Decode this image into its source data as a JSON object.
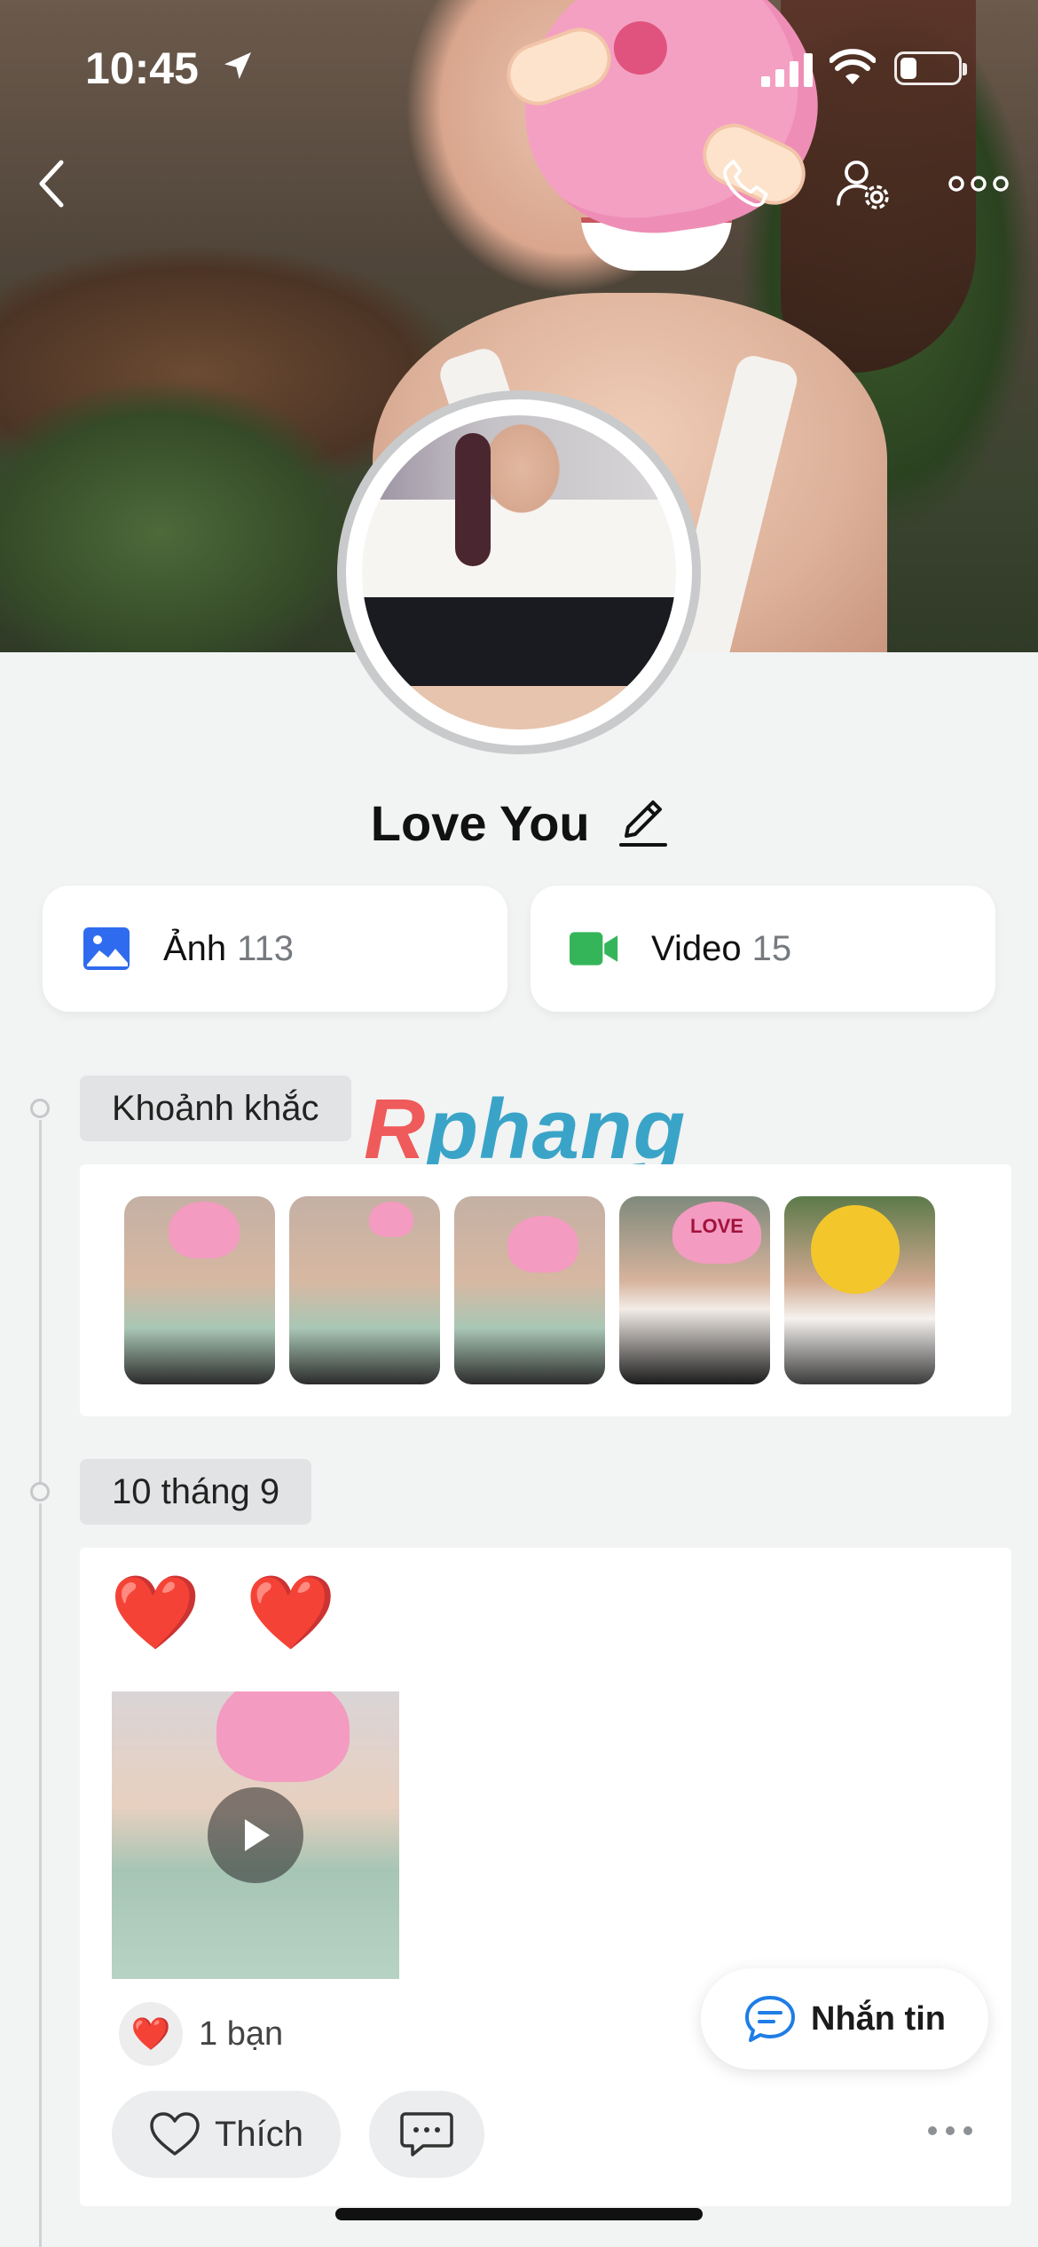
{
  "status_bar": {
    "time": "10:45"
  },
  "profile": {
    "name": "Love You"
  },
  "media": {
    "photos": {
      "label": "Ảnh",
      "count": "113"
    },
    "videos": {
      "label": "Video",
      "count": "15"
    }
  },
  "watermark": {
    "part1": "R",
    "part2": "phang"
  },
  "moments": {
    "label": "Khoảnh khắc",
    "items": [
      {
        "sticker": ""
      },
      {
        "sticker": ""
      },
      {
        "sticker": ""
      },
      {
        "sticker": "LOVE"
      },
      {
        "sticker": ""
      }
    ]
  },
  "post": {
    "date": "10 tháng 9",
    "text": "❤️ ❤️",
    "reaction_icon": "❤️",
    "reaction_count": "1 bạn",
    "like_label": "Thích"
  },
  "message_button": {
    "label": "Nhắn tin"
  },
  "icons": {
    "back": "back-chevron-icon",
    "call": "phone-icon",
    "profile_settings": "user-gear-icon",
    "more": "more-horizontal-icon"
  },
  "colors": {
    "photo_icon": "#2f6bef",
    "video_icon": "#35b55a",
    "accent": "#1f7de6"
  }
}
